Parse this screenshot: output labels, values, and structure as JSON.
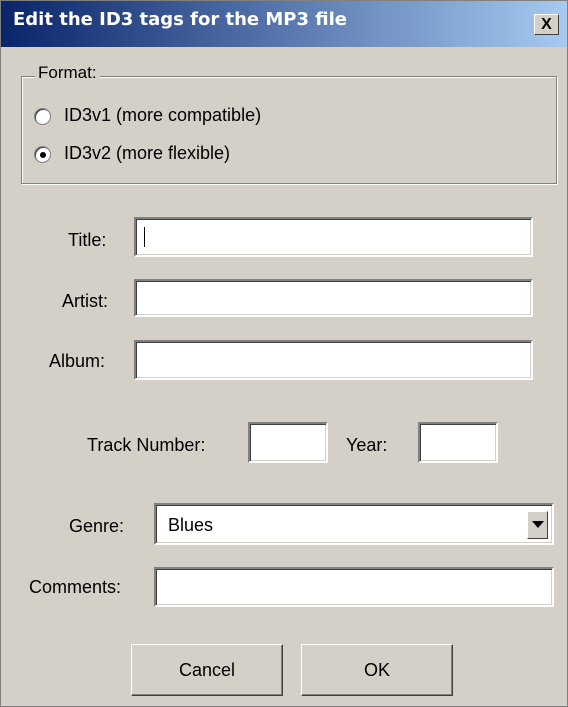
{
  "title": "Edit the ID3 tags for the MP3 file",
  "close_label": "X",
  "format": {
    "legend": "Format:",
    "options": [
      {
        "label": "ID3v1 (more compatible)",
        "selected": false
      },
      {
        "label": "ID3v2 (more flexible)",
        "selected": true
      }
    ]
  },
  "fields": {
    "title_label": "Title:",
    "title_value": "",
    "artist_label": "Artist:",
    "artist_value": "",
    "album_label": "Album:",
    "album_value": "",
    "track_label": "Track Number:",
    "track_value": "",
    "year_label": "Year:",
    "year_value": "",
    "genre_label": "Genre:",
    "genre_value": "Blues",
    "comments_label": "Comments:",
    "comments_value": ""
  },
  "buttons": {
    "cancel": "Cancel",
    "ok": "OK"
  }
}
